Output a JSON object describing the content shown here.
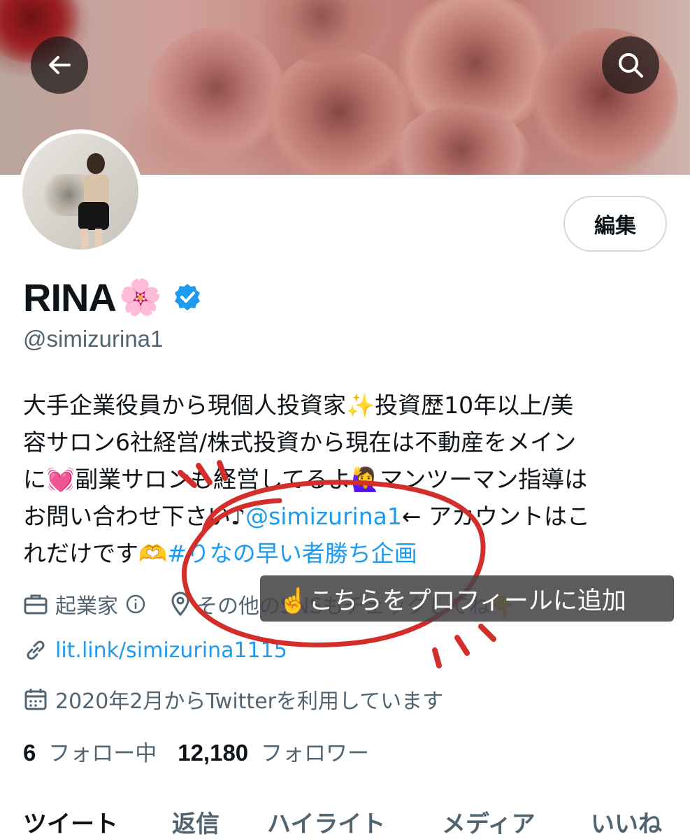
{
  "header": {
    "back_icon": "arrow-left-icon",
    "search_icon": "search-icon"
  },
  "profile": {
    "edit_label": "編集",
    "name": "RINA",
    "name_emoji": "🌸",
    "verified_icon": "verified-badge-icon",
    "handle": "@simizurina1",
    "bio": {
      "line1": "大手企業役員から現個人投資家✨投資歴10年以上/美",
      "line2": "容サロン6社経営/株式投資から現在は不動産をメイン",
      "line3": "に💓副業サロンも経営してるよ🙋‍♀️マンツーマン指導は",
      "line4_prefix": "お問い合わせ下さい♪",
      "line4_link": "@simizurina1",
      "line4_suffix": "← アカウントはこ",
      "line5_prefix": "れだけです🫶",
      "line5_link": "#りなの早い者勝ち企画"
    },
    "profession": "起業家",
    "location": "その他のSNSもチェックしてね👇",
    "website": "lit.link/simizurina1115",
    "joined": "2020年2月からTwitterを利用しています",
    "following_count": "6",
    "following_label": "フォロー中",
    "followers_count": "12,180",
    "followers_label": "フォロワー"
  },
  "tooltip": {
    "text": "☝️こちらをプロフィールに追加"
  },
  "tabs": [
    "ツイート",
    "返信",
    "ハイライト",
    "メディア",
    "いいね"
  ],
  "colors": {
    "link": "#1d9bf0",
    "secondary_text": "#536471",
    "annotation_red": "#d42e2a"
  }
}
